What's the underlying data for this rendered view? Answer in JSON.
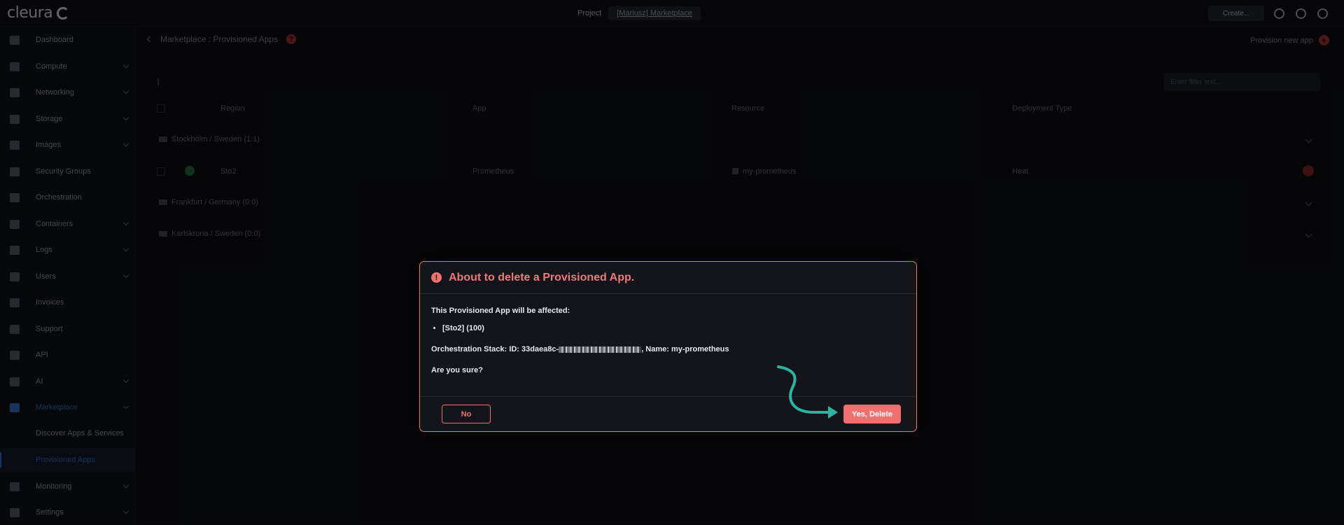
{
  "app": {
    "logo_text": "cleura"
  },
  "topbar": {
    "project_label": "Project",
    "project_value": "[Mariusz] Marketplace",
    "create_label": "Create..."
  },
  "sidebar": {
    "items": [
      {
        "label": "Dashboard",
        "icon": "dashboard-icon",
        "has_chevron": false
      },
      {
        "label": "Compute",
        "icon": "compute-icon",
        "has_chevron": true
      },
      {
        "label": "Networking",
        "icon": "networking-icon",
        "has_chevron": true
      },
      {
        "label": "Storage",
        "icon": "storage-icon",
        "has_chevron": true
      },
      {
        "label": "Images",
        "icon": "images-icon",
        "has_chevron": true
      },
      {
        "label": "Security Groups",
        "icon": "shield-icon",
        "has_chevron": false
      },
      {
        "label": "Orchestration",
        "icon": "orchestration-icon",
        "has_chevron": false
      },
      {
        "label": "Containers",
        "icon": "containers-icon",
        "has_chevron": true
      },
      {
        "label": "Logs",
        "icon": "logs-icon",
        "has_chevron": true
      },
      {
        "label": "Users",
        "icon": "users-icon",
        "has_chevron": true
      },
      {
        "label": "Invoices",
        "icon": "invoices-icon",
        "has_chevron": false
      },
      {
        "label": "Support",
        "icon": "support-icon",
        "has_chevron": false
      },
      {
        "label": "API",
        "icon": "api-icon",
        "has_chevron": false
      },
      {
        "label": "AI",
        "icon": "ai-icon",
        "has_chevron": true
      },
      {
        "label": "Marketplace",
        "icon": "cart-icon",
        "has_chevron": true
      },
      {
        "label": "Monitoring",
        "icon": "monitoring-icon",
        "has_chevron": true
      },
      {
        "label": "Settings",
        "icon": "gear-icon",
        "has_chevron": true
      }
    ],
    "subitems": [
      {
        "label": "Discover Apps & Services"
      },
      {
        "label": "Provisioned Apps"
      }
    ]
  },
  "main": {
    "breadcrumb": "Marketplace : Provisioned Apps",
    "provision_label": "Provision new app",
    "filter_placeholder": "Enter filter text...",
    "columns": [
      "Region",
      "App",
      "Resource",
      "Deployment Type"
    ],
    "groups": [
      {
        "label": "Stockholm / Sweden (1:1)"
      },
      {
        "label": "Frankfurt / Germany (0:0)"
      },
      {
        "label": "Karlskrona / Sweden (0:0)"
      }
    ],
    "row": {
      "region": "Sto2",
      "app": "Prometheus",
      "resource": "my-prometheus",
      "deployment_type": "Heat"
    }
  },
  "dialog": {
    "title": "About to delete a Provisioned App.",
    "affected_text": "This Provisioned App will be affected:",
    "affected_item": "[Sto2] (100)",
    "stack_prefix": "Orchestration Stack: ID: 33daea8c-",
    "stack_suffix": ", Name: my-prometheus",
    "confirm_text": "Are you sure?",
    "no_label": "No",
    "yes_label": "Yes, Delete",
    "accent_color": "#f07070",
    "arrow_color": "#2ab5a0"
  }
}
